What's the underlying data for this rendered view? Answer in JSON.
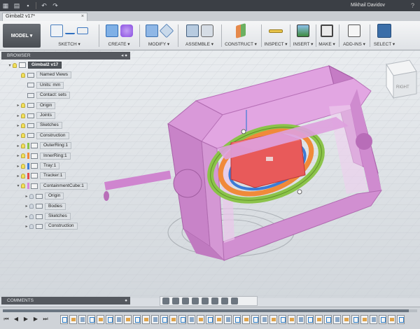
{
  "app": {
    "user_name": "Mikhail Davidov",
    "help": "?"
  },
  "tab": {
    "title": "Gimbal2 v17*",
    "close": "×"
  },
  "toolbar": {
    "workspace": "MODEL ▾",
    "groups": [
      {
        "id": "sketch",
        "label": "SKETCH ▾"
      },
      {
        "id": "create",
        "label": "CREATE ▾"
      },
      {
        "id": "modify",
        "label": "MODIFY ▾"
      },
      {
        "id": "assemble",
        "label": "ASSEMBLE ▾"
      },
      {
        "id": "construct",
        "label": "CONSTRUCT ▾"
      },
      {
        "id": "inspect",
        "label": "INSPECT ▾"
      },
      {
        "id": "insert",
        "label": "INSERT ▾"
      },
      {
        "id": "make",
        "label": "MAKE ▾"
      },
      {
        "id": "addins",
        "label": "ADD-INS ▾"
      },
      {
        "id": "select",
        "label": "SELECT ▾"
      }
    ]
  },
  "browser": {
    "title": "BROWSER",
    "items": [
      {
        "label": "Gimbal2 v17",
        "depth": 0,
        "type": "root"
      },
      {
        "label": "Named Views",
        "depth": 1,
        "type": "folder"
      },
      {
        "label": "Units: mm",
        "depth": 1,
        "type": "doc"
      },
      {
        "label": "Contact: sets",
        "depth": 1,
        "type": "doc"
      },
      {
        "label": "Origin",
        "depth": 1,
        "type": "folder"
      },
      {
        "label": "Joints",
        "depth": 1,
        "type": "folder"
      },
      {
        "label": "Sketches",
        "depth": 1,
        "type": "folder"
      },
      {
        "label": "Construction",
        "depth": 1,
        "type": "folder"
      },
      {
        "label": "OuterRing:1",
        "depth": 1,
        "type": "comp",
        "color": "#8bc34a"
      },
      {
        "label": "InnerRing:1",
        "depth": 1,
        "type": "comp",
        "color": "#f08a3a"
      },
      {
        "label": "Tray:1",
        "depth": 1,
        "type": "comp",
        "color": "#3d7bd6"
      },
      {
        "label": "Tracker:1",
        "depth": 1,
        "type": "comp",
        "color": "#e34b4b"
      },
      {
        "label": "ContainmentCube:1",
        "depth": 1,
        "type": "comp",
        "color": "#d987d9"
      },
      {
        "label": "Origin",
        "depth": 2,
        "type": "folder"
      },
      {
        "label": "Bodies",
        "depth": 2,
        "type": "folder"
      },
      {
        "label": "Sketches",
        "depth": 2,
        "type": "folder"
      },
      {
        "label": "Construction",
        "depth": 2,
        "type": "folder"
      }
    ]
  },
  "viewcube": {
    "face": "RIGHT"
  },
  "comments": {
    "title": "COMMENTS"
  },
  "timeline": {
    "progress": 0.98
  },
  "colors": {
    "cube": "#d68ad6",
    "outer_ring": "#8bc34a",
    "inner_ring": "#f08a3a",
    "tray": "#3d7bd6",
    "tracker": "#e85a5a"
  }
}
